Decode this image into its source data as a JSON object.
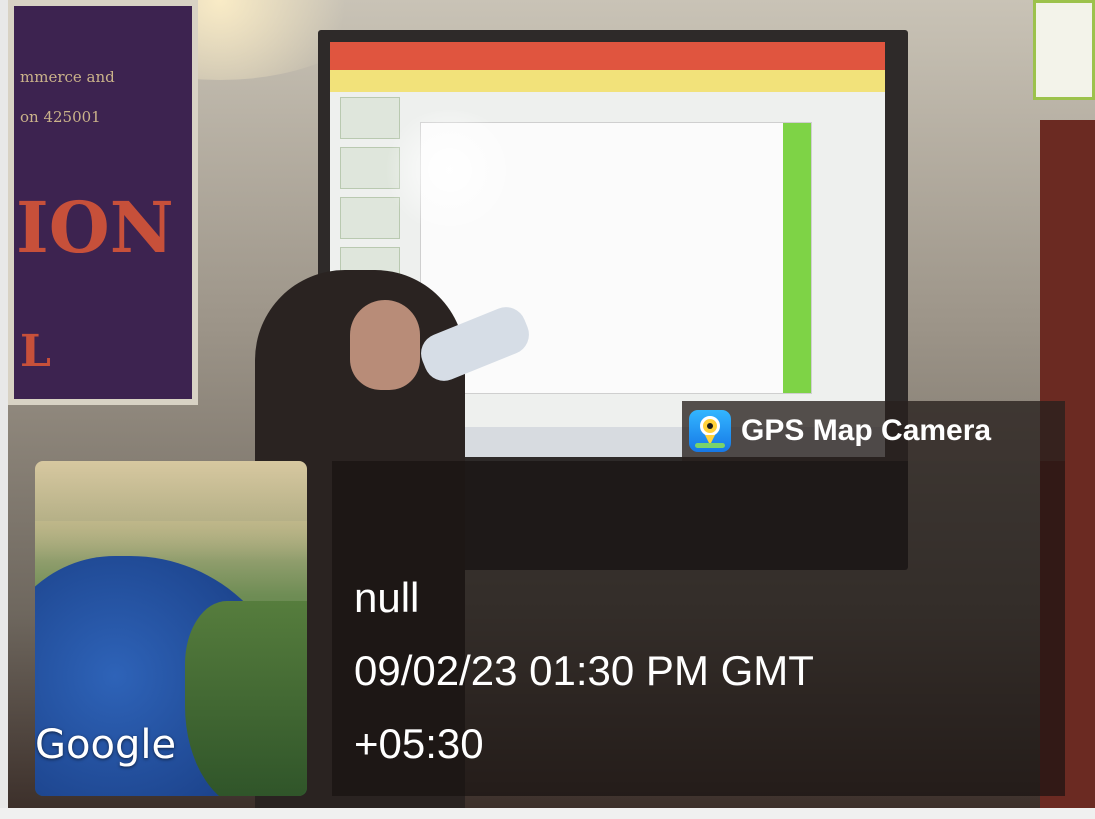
{
  "overlay": {
    "app_name": "GPS Map Camera",
    "address": "null",
    "datetime": "09/02/23 01:30 PM GMT",
    "timezone": "+05:30",
    "map_attribution": "Google",
    "app_icon": "gps-map-camera-icon",
    "text_color": "#ffffff",
    "panel_color": "#1a1210"
  },
  "background_photo": {
    "banner_text_large": "ION",
    "banner_text_small_1": "mmerce and",
    "banner_text_small_2": "on 425001",
    "banner_text_bottom": "L"
  }
}
